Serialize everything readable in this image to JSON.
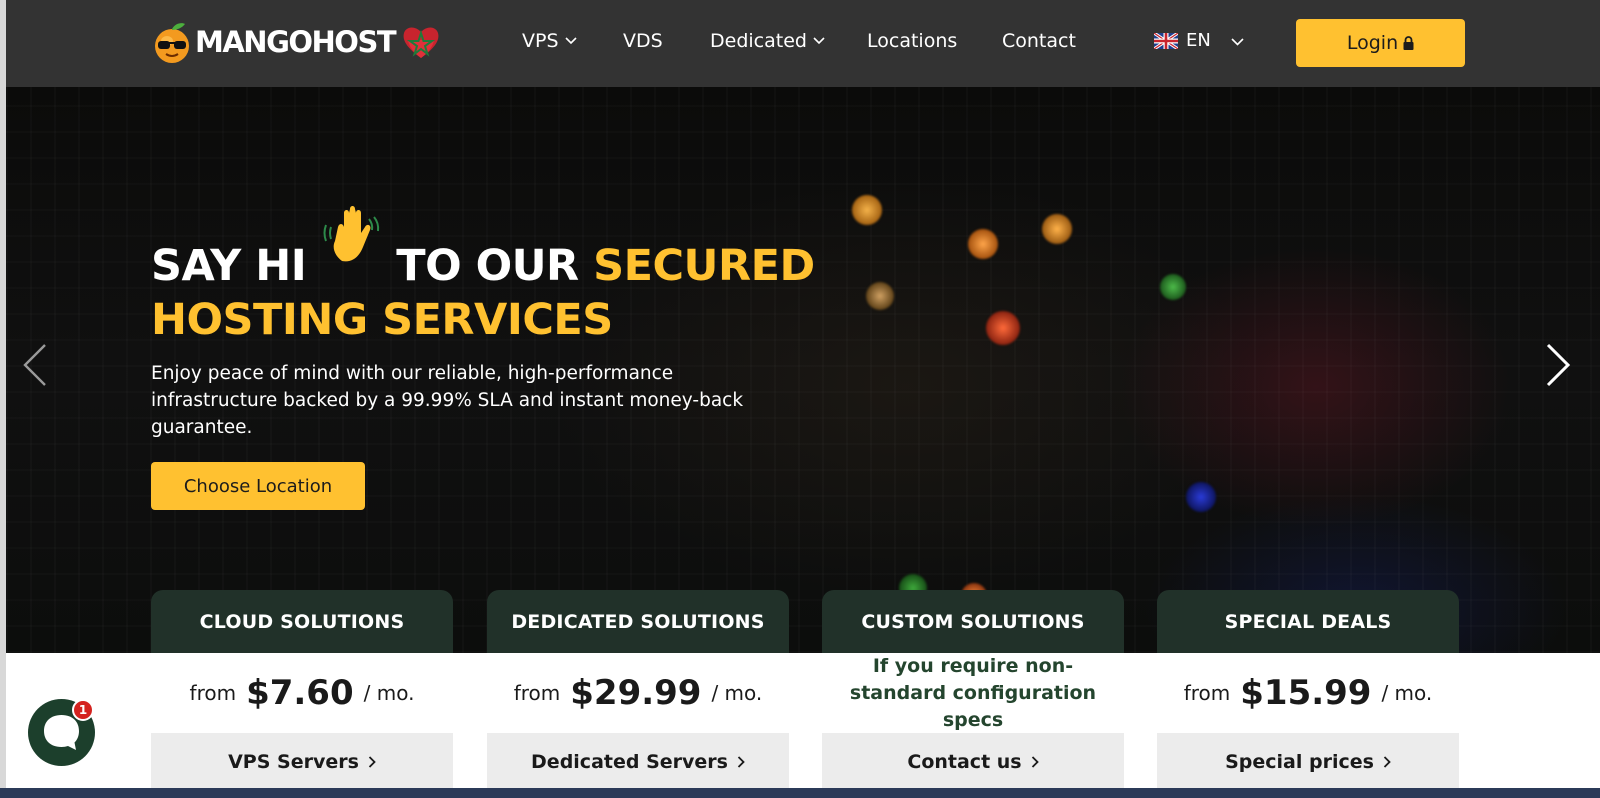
{
  "brand": {
    "name": "MANGOHOST"
  },
  "nav": {
    "items": [
      {
        "label": "VPS",
        "has_dropdown": true
      },
      {
        "label": "VDS",
        "has_dropdown": false
      },
      {
        "label": "Dedicated",
        "has_dropdown": true
      },
      {
        "label": "Locations",
        "has_dropdown": false
      },
      {
        "label": "Contact",
        "has_dropdown": false
      }
    ],
    "language": "EN",
    "login_label": "Login"
  },
  "hero": {
    "title_part1": "SAY HI",
    "title_part2": "TO OUR",
    "title_accent_1": "SECURED",
    "title_accent_2": "HOSTING SERVICES",
    "description": "Enjoy peace of mind with our reliable, high-performance infrastructure backed by a 99.99% SLA and instant money-back guarantee.",
    "cta_label": "Choose Location"
  },
  "cards": [
    {
      "title": "CLOUD SOLUTIONS",
      "from": "from",
      "price": "$7.60",
      "per": "/ mo.",
      "link": "VPS Servers"
    },
    {
      "title": "DEDICATED SOLUTIONS",
      "from": "from",
      "price": "$29.99",
      "per": "/ mo.",
      "link": "Dedicated Servers"
    },
    {
      "title": "CUSTOM SOLUTIONS",
      "text": "If you require non-standard configuration specs",
      "link": "Contact us"
    },
    {
      "title": "SPECIAL DEALS",
      "from": "from",
      "price": "$15.99",
      "per": "/ mo.",
      "link": "Special prices"
    }
  ],
  "chat": {
    "badge_count": "1"
  },
  "colors": {
    "header_bg": "#333333",
    "accent_yellow": "#ffc130",
    "card_header_green": "#213129",
    "card_footer_gray": "#ececec",
    "chat_green": "#1c3f2c",
    "badge_red": "#d4231f"
  },
  "icons": [
    "mango-logo-icon",
    "heart-flag-icon",
    "chevron-down-icon",
    "uk-flag-icon",
    "lock-icon",
    "waving-hand-icon",
    "arrow-left-icon",
    "arrow-right-icon",
    "chevron-right-icon",
    "chat-icon"
  ]
}
